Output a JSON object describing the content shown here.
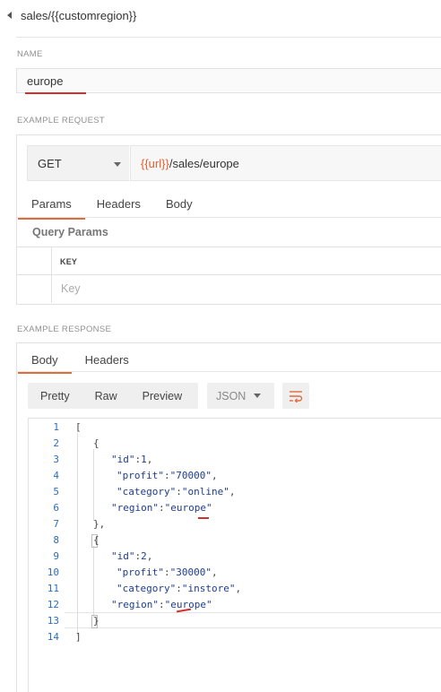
{
  "breadcrumb": {
    "path": "sales/{{customregion}}"
  },
  "name_section": {
    "label": "NAME",
    "value": "europe"
  },
  "request": {
    "label": "EXAMPLE REQUEST",
    "method": "GET",
    "url_variable": "{{url}}",
    "url_path": "/sales/europe",
    "tabs": [
      {
        "label": "Params",
        "active": true
      },
      {
        "label": "Headers",
        "active": false
      },
      {
        "label": "Body",
        "active": false
      }
    ],
    "query_params_title": "Query Params",
    "key_header": "KEY",
    "key_placeholder": "Key"
  },
  "response": {
    "label": "EXAMPLE RESPONSE",
    "tabs": [
      {
        "label": "Body",
        "active": true
      },
      {
        "label": "Headers",
        "active": false
      }
    ],
    "format_buttons": [
      "Pretty",
      "Raw",
      "Preview"
    ],
    "language": "JSON",
    "line_numbers": [
      "1",
      "2",
      "3",
      "4",
      "5",
      "6",
      "7",
      "8",
      "9",
      "10",
      "11",
      "12",
      "13",
      "14"
    ],
    "code": {
      "l1": "[",
      "l2": "{",
      "l3_key": "\"id\"",
      "l3_val": "1",
      "l4_key": "\"profit\"",
      "l4_val": "\"70000\"",
      "l5_key": "\"category\"",
      "l5_val": "\"online\"",
      "l6_key": "\"region\"",
      "l6_val": "\"europe\"",
      "l7": "},",
      "l8": "{",
      "l9_key": "\"id\"",
      "l9_val": "2",
      "l10_key": "\"profit\"",
      "l10_val": "\"30000\"",
      "l11_key": "\"category\"",
      "l11_val": "\"instore\"",
      "l12_key": "\"region\"",
      "l12_val": "\"europe\"",
      "l13": "}",
      "l14": "]"
    }
  },
  "colors": {
    "accent_orange": "#e06b3c",
    "annotation_red": "#d32f2f",
    "code_blue": "#1e3d8f",
    "line_number_blue": "#2a6ebb"
  }
}
